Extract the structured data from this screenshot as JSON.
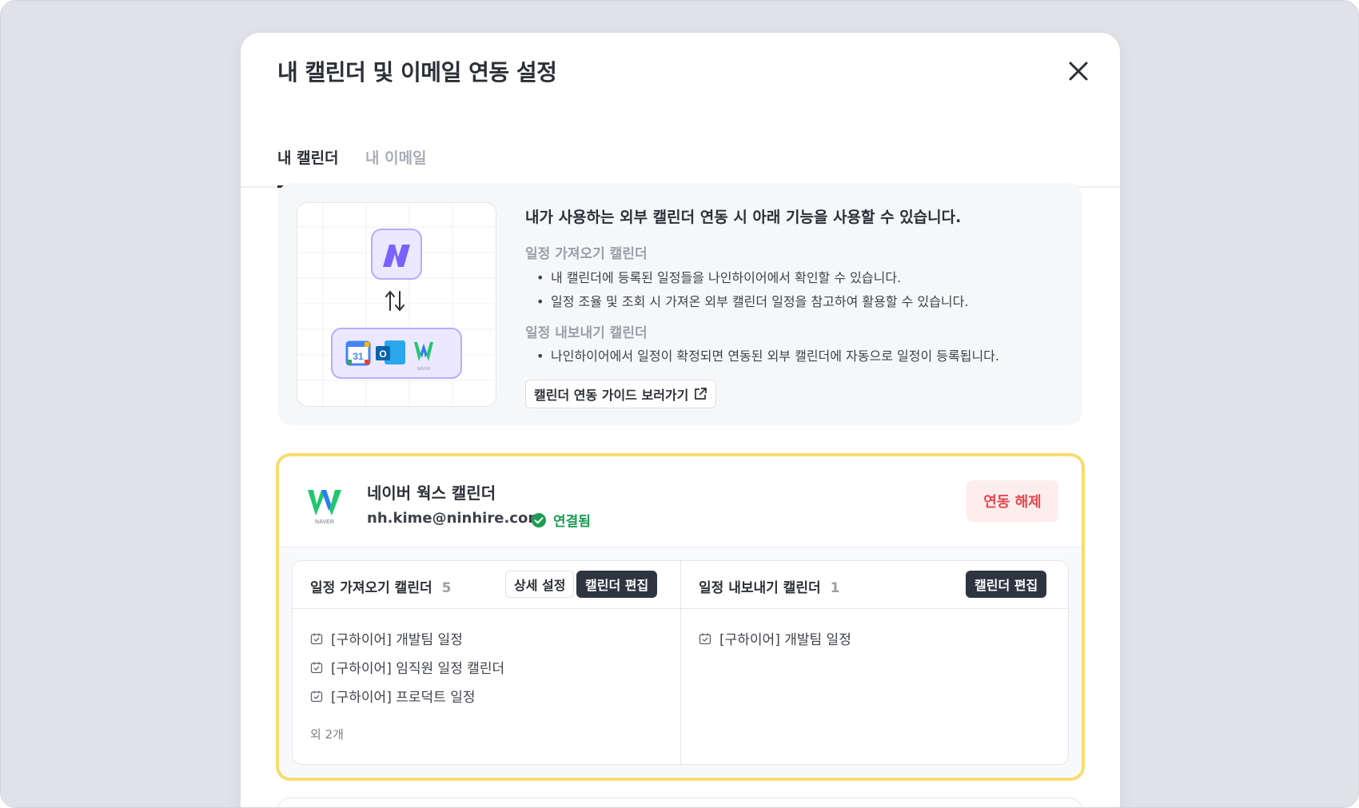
{
  "modal": {
    "title": "내 캘린더 및 이메일 연동 설정"
  },
  "tabs": [
    {
      "label": "내 캘린더"
    },
    {
      "label": "내 이메일"
    }
  ],
  "info": {
    "heading": "내가 사용하는 외부 캘린더 연동 시 아래 기능을 사용할 수 있습니다.",
    "import_title": "일정 가져오기 캘린더",
    "import_bullets": [
      "내 캘린더에 등록된 일정들을 나인하이어에서 확인할 수 있습니다.",
      "일정 조율 및 조회 시 가져온 외부 캘린더 일정을 참고하여 활용할 수 있습니다."
    ],
    "export_title": "일정 내보내기 캘린더",
    "export_bullets": [
      "나인하이어에서 일정이 확정되면 연동된 외부 캘린더에 자동으로 일정이 등록됩니다."
    ],
    "guide_button": "캘린더 연동 가이드 보러가기",
    "illustration": {
      "gcal_day": "31",
      "outlook_letter": "O",
      "naver_caption": "NAVER"
    }
  },
  "account": {
    "logo_caption": "NAVER",
    "name": "네이버 웍스 캘린더",
    "email": "nh.kime@ninhire.com",
    "status": "연결됨",
    "disconnect_button": "연동 해제",
    "import": {
      "title": "일정 가져오기 캘린더",
      "count": "5",
      "settings_button": "상세 설정",
      "edit_button": "캘린더 편집",
      "items": [
        "[구하이어] 개발팀 일정",
        "[구하이어] 임직원 일정 캘린더",
        "[구하이어] 프로덕트 일정"
      ],
      "more": "외 2개"
    },
    "export": {
      "title": "일정 내보내기 캘린더",
      "count": "1",
      "edit_button": "캘린더 편집",
      "items": [
        "[구하이어] 개발팀 일정"
      ]
    }
  },
  "colors": {
    "highlight_border": "#f7dc6f",
    "connected": "#1f9d55",
    "disconnect": "#e5484d",
    "brand_purple": "#7b61ff"
  }
}
